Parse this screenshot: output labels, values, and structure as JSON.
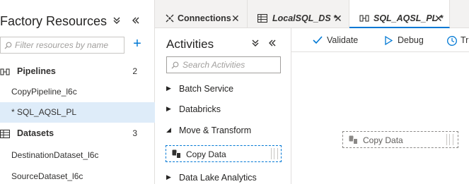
{
  "resources": {
    "title": "Factory Resources",
    "search_placeholder": "Filter resources by name",
    "sections": [
      {
        "label": "Pipelines",
        "count": "2"
      },
      {
        "label": "Datasets",
        "count": "3"
      }
    ],
    "pipelines": [
      "CopyPipeline_l6c",
      "* SQL_AQSL_PL"
    ],
    "datasets": [
      "DestinationDataset_l6c",
      "SourceDataset_l6c"
    ]
  },
  "tabs": [
    {
      "label": "Connections"
    },
    {
      "label": "LocalSQL_DS *"
    },
    {
      "label": "SQL_AQSL_PL *"
    }
  ],
  "activities": {
    "title": "Activities",
    "search_placeholder": "Search Activities",
    "categories": [
      "Batch Service",
      "Databricks",
      "Move & Transform",
      "Data Lake Analytics"
    ],
    "item": "Copy Data"
  },
  "toolbar": {
    "validate": "Validate",
    "debug": "Debug",
    "trigger_partial": "Tr"
  },
  "canvas": {
    "node_label": "Copy Data"
  },
  "colors": {
    "accent": "#0078d4",
    "selected_row": "#deecf9",
    "tabbar_bg": "#f3f2f1"
  }
}
